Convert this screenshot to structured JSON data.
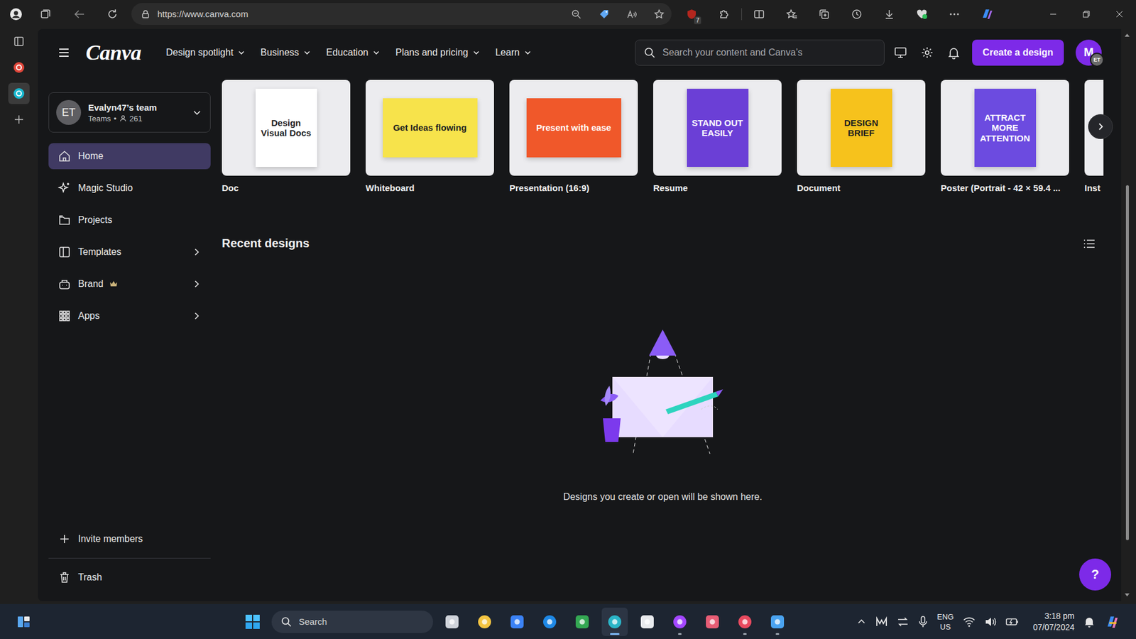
{
  "browser": {
    "url": "https://www.canva.com",
    "extension_badge": "7"
  },
  "vertical_tabs": [
    {
      "selected": false,
      "color": "#e0463a"
    },
    {
      "selected": true,
      "color": "#18b8cf"
    }
  ],
  "canva": {
    "logo": "Canva",
    "nav": [
      "Design spotlight",
      "Business",
      "Education",
      "Plans and pricing",
      "Learn"
    ],
    "search_placeholder": "Search your content and Canva’s",
    "create_button": "Create a design",
    "avatar": {
      "initial": "M",
      "badge": "ET"
    },
    "team": {
      "initials": "ET",
      "name": "Evalyn47’s team",
      "plan": "Teams",
      "separator": "•",
      "members": "261"
    },
    "sidebar": [
      {
        "label": "Home",
        "selected": true,
        "submenu": false,
        "premium": false
      },
      {
        "label": "Magic Studio",
        "selected": false,
        "submenu": false,
        "premium": false
      },
      {
        "label": "Projects",
        "selected": false,
        "submenu": false,
        "premium": false
      },
      {
        "label": "Templates",
        "selected": false,
        "submenu": true,
        "premium": false
      },
      {
        "label": "Brand",
        "selected": false,
        "submenu": true,
        "premium": true
      },
      {
        "label": "Apps",
        "selected": false,
        "submenu": true,
        "premium": false
      }
    ],
    "invite": "Invite members",
    "trash": "Trash",
    "templates": [
      {
        "label": "Doc",
        "thumb": "Design Visual Docs",
        "kind": "portrait",
        "color": "#ffffff"
      },
      {
        "label": "Whiteboard",
        "thumb": "Get Ideas flowing",
        "kind": "landscape",
        "color": "#f7e34b"
      },
      {
        "label": "Presentation (16:9)",
        "thumb": "Present with ease",
        "kind": "landscape",
        "color": "#f0582a"
      },
      {
        "label": "Resume",
        "thumb": "STAND OUT EASILY",
        "kind": "portrait",
        "color": "#6b3fd6"
      },
      {
        "label": "Document",
        "thumb": "DESIGN BRIEF",
        "kind": "portrait",
        "color": "#f6c21c"
      },
      {
        "label": "Poster (Portrait - 42 × 59.4 ...",
        "thumb": "ATTRACT MORE ATTENTION",
        "kind": "portrait",
        "color": "#6c4be0"
      },
      {
        "label": "Inst",
        "thumb": "",
        "kind": "portrait",
        "color": "#f3d7c4"
      }
    ],
    "recent_title": "Recent designs",
    "empty_text": "Designs you create or open will be shown here.",
    "help": "?"
  },
  "taskbar": {
    "search": "Search",
    "lang": "ENG",
    "region": "US",
    "time": "3:18 pm",
    "date": "07/07/2024",
    "apps": [
      {
        "color": "#cfd3da",
        "running": false,
        "active": false
      },
      {
        "color": "#f4c542",
        "running": false,
        "active": false
      },
      {
        "color": "#3b82f6",
        "running": false,
        "active": false
      },
      {
        "color": "#1e88e5",
        "running": false,
        "active": false
      },
      {
        "color": "#34a853",
        "running": false,
        "active": false
      },
      {
        "color": "#2bb5c8",
        "running": true,
        "active": true
      },
      {
        "color": "#e8eaed",
        "running": false,
        "active": false
      },
      {
        "color": "#a347ff",
        "running": true,
        "active": false
      },
      {
        "color": "#e85d75",
        "running": false,
        "active": false
      },
      {
        "color": "#e84a5f",
        "running": true,
        "active": false
      },
      {
        "color": "#4aa3f0",
        "running": true,
        "active": false
      }
    ]
  }
}
